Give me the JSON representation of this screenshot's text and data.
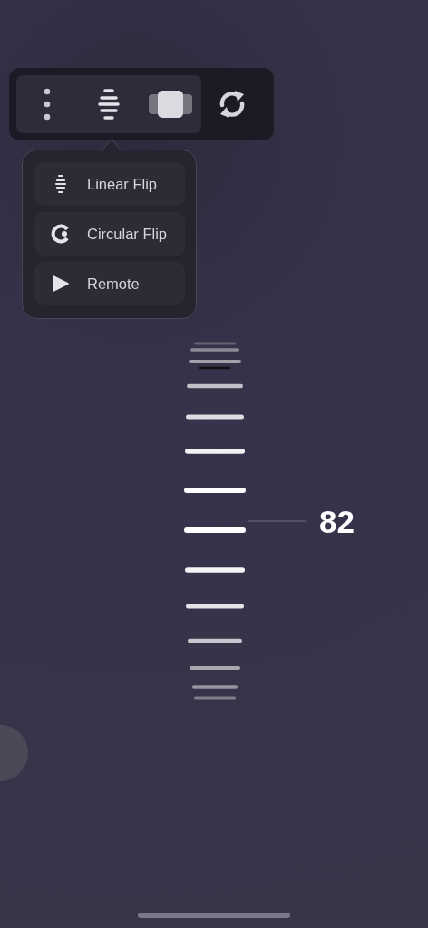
{
  "toolbar": {
    "buttons": [
      {
        "kind": "more"
      },
      {
        "kind": "linear"
      },
      {
        "kind": "cards"
      },
      {
        "kind": "refresh"
      }
    ]
  },
  "menu": {
    "items": [
      {
        "kind": "linear",
        "label": "Linear Flip"
      },
      {
        "kind": "circular",
        "label": "Circular Flip"
      },
      {
        "kind": "remote",
        "label": "Remote"
      }
    ]
  },
  "ruler": {
    "value": "82"
  }
}
